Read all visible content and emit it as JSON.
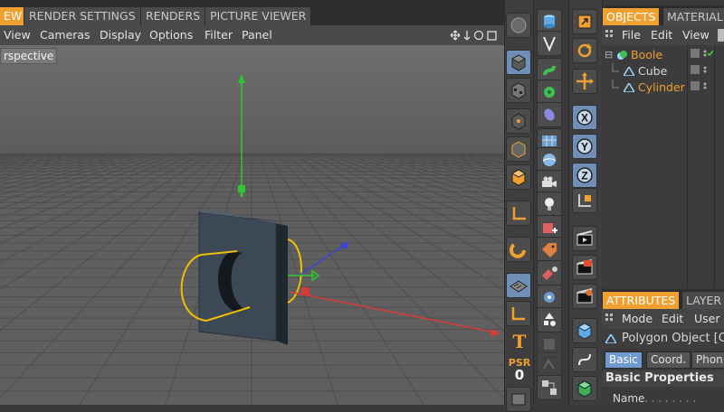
{
  "top_tabs": [
    "EW",
    "RENDER SETTINGS",
    "RENDERS",
    "PICTURE VIEWER"
  ],
  "viewport_menu": [
    "View",
    "Cameras",
    "Display",
    "Options",
    "Filter",
    "Panel"
  ],
  "viewport_label": "rspective",
  "colors": {
    "accent": "#f0a030",
    "highlight": "#6f9ad0",
    "axis_x": "#d03030",
    "axis_y": "#30c030",
    "axis_z": "#3040d0",
    "selection": "#f0c000"
  },
  "object_tabs": [
    "OBJECTS",
    "MATERIAL"
  ],
  "object_menu": [
    "File",
    "Edit",
    "View"
  ],
  "objects": [
    {
      "name": "Boole",
      "icon": "boole-icon",
      "indent": 0,
      "selected": true
    },
    {
      "name": "Cube",
      "icon": "cube-object-icon",
      "indent": 1,
      "selected": false
    },
    {
      "name": "Cylinder",
      "icon": "cylinder-object-icon",
      "indent": 1,
      "selected": true
    }
  ],
  "attribute_tabs": [
    "ATTRIBUTES",
    "LAYER"
  ],
  "attribute_menu": [
    "Mode",
    "Edit",
    "User"
  ],
  "attribute_title": "Polygon Object [C",
  "attribute_buttons": [
    "Basic",
    "Coord.",
    "Phon"
  ],
  "basic_properties": "Basic Properties",
  "name_field_label": "Name",
  "psr_label": "PSR",
  "psr_value": "0",
  "axis_buttons": [
    "X",
    "Y",
    "Z"
  ]
}
